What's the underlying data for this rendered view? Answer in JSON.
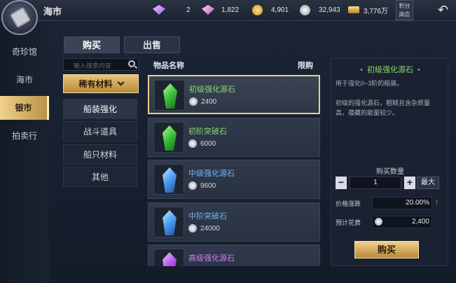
{
  "app": {
    "title": "海市",
    "emblem_icon": "scroll-icon"
  },
  "currencies": [
    {
      "icon": "purple-gem-icon",
      "value": "2"
    },
    {
      "icon": "pink-gem-icon",
      "value": "1,822"
    },
    {
      "icon": "gold-coin-icon",
      "value": "4,901"
    },
    {
      "icon": "silver-coin-icon",
      "value": "32,943"
    },
    {
      "icon": "gold-ingot-icon",
      "value": "3,776万"
    }
  ],
  "points_shop_label": "积分商店",
  "back_icon": "back-arrow-icon",
  "leftnav": [
    {
      "label": "奇珍馆"
    },
    {
      "label": "海市"
    },
    {
      "label": "银市",
      "active": true
    },
    {
      "label": "拍卖行"
    }
  ],
  "tabs": [
    {
      "label": "购买",
      "active": true
    },
    {
      "label": "出售"
    }
  ],
  "search": {
    "placeholder": "输入搜索内容"
  },
  "filter": {
    "label": "稀有材料"
  },
  "categories": [
    {
      "label": "船装强化",
      "active": true
    },
    {
      "label": "战斗道具"
    },
    {
      "label": "船只材料"
    },
    {
      "label": "其他"
    }
  ],
  "list_header": {
    "name": "物品名称",
    "limit": "限购"
  },
  "items": [
    {
      "name": "初级强化源石",
      "price": "2400",
      "color": "green",
      "selected": true
    },
    {
      "name": "初阶突破石",
      "price": "6000",
      "color": "green"
    },
    {
      "name": "中级强化源石",
      "price": "9600",
      "color": "blue"
    },
    {
      "name": "中阶突破石",
      "price": "24000",
      "color": "blue"
    },
    {
      "name": "高级强化源石",
      "price": "",
      "color": "purple"
    }
  ],
  "detail": {
    "title": "初级强化源石",
    "desc1": "用于强化0~3阶的船装。",
    "desc2": "初级的强化源石，粗糙且含杂质量高，蕴藏的能量较少。",
    "qty_label": "购买数量",
    "qty": "1",
    "max_label": "最大",
    "price_change_label": "价格涨跌",
    "price_change": "20.00%",
    "cost_label": "预计花费",
    "cost": "2,400",
    "buy_label": "购买"
  },
  "colors": {
    "accent_gold": "#e8c37a",
    "green_name": "#8ed66e",
    "blue_name": "#74b6f0",
    "purple_name": "#cc82ee"
  }
}
